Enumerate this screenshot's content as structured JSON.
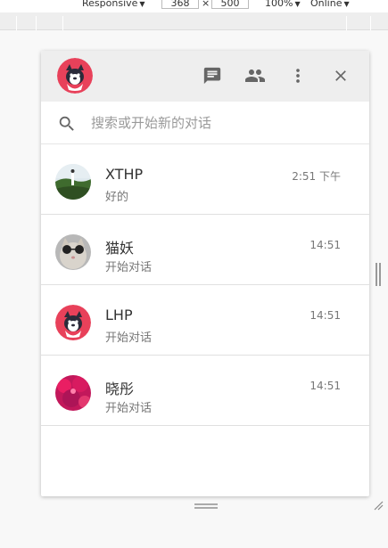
{
  "devtools": {
    "device_label": "Responsive",
    "width_value": "368",
    "times": "×",
    "height_value": "500",
    "zoom_label": "100%",
    "network_label": "Online"
  },
  "app": {
    "header": {
      "chat_icon": "chat-bubble-icon",
      "contacts_icon": "people-icon",
      "more_icon": "more-vert-icon",
      "close_icon": "close-icon"
    },
    "search": {
      "placeholder": "搜索或开始新的对话"
    },
    "conversations": [
      {
        "name": "XTHP",
        "preview": "好的",
        "time": "2:51 下午",
        "avatar": "landscape-photo"
      },
      {
        "name": "猫妖",
        "preview": "开始对话",
        "time": "14:51",
        "avatar": "cat-with-sunglasses"
      },
      {
        "name": "LHP",
        "preview": "开始对话",
        "time": "14:51",
        "avatar": "husky-cartoon"
      },
      {
        "name": "晓彤",
        "preview": "开始对话",
        "time": "14:51",
        "avatar": "flowers-pink"
      }
    ]
  },
  "colors": {
    "header_bg": "#eeeeee",
    "icon_gray": "#666666",
    "avatar_red": "#e8415a",
    "divider": "#e0e0e0"
  }
}
